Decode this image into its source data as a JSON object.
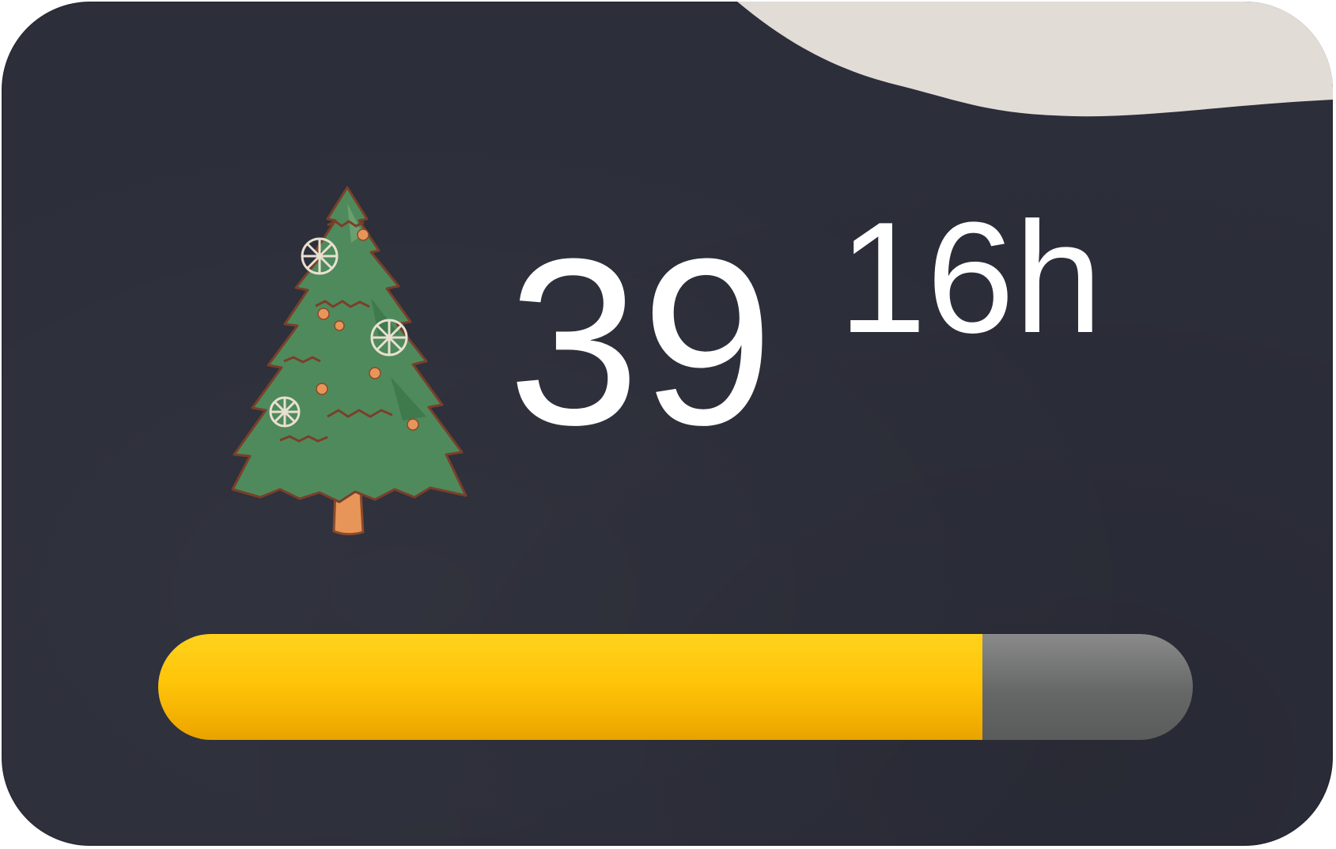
{
  "countdown": {
    "days": "39",
    "hours": "16h"
  },
  "progress": {
    "fraction": 0.797,
    "fill_color": "#ffc400",
    "track_color": "#6b6c6c"
  },
  "icons": {
    "tree": "christmas-tree-icon"
  },
  "colors": {
    "background": "#2c2e3a",
    "snow": "#e2dcd6",
    "text": "#ffffff"
  }
}
